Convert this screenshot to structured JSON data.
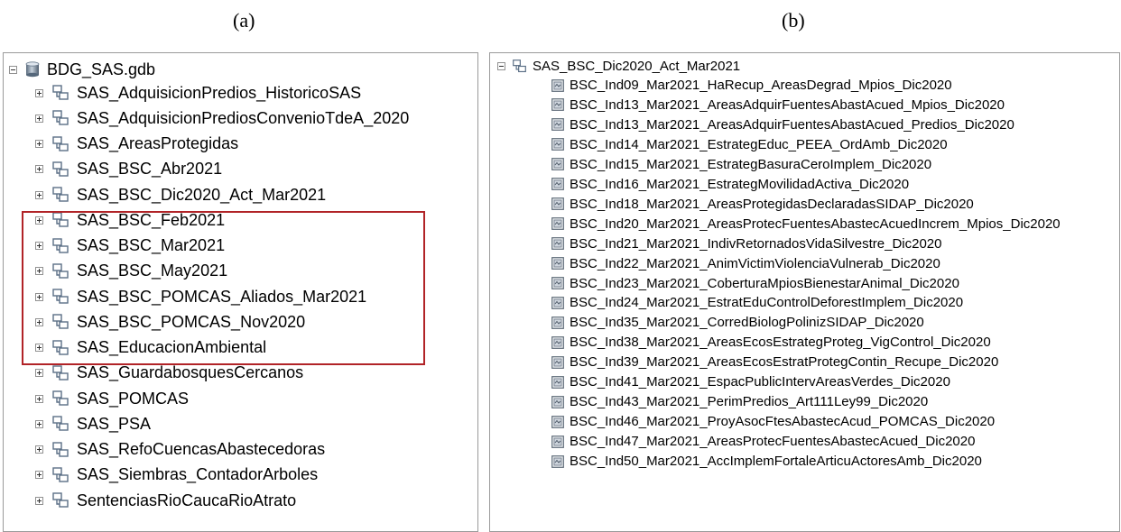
{
  "captions": {
    "left": "(a)",
    "right": "(b)"
  },
  "colors": {
    "highlight": "#b12327"
  },
  "catalog": {
    "root_label": "BDG_SAS.gdb",
    "datasets": [
      "SAS_AdquisicionPredios_HistoricoSAS",
      "SAS_AdquisicionPrediosConvenioTdeA_2020",
      "SAS_AreasProtegidas",
      "SAS_BSC_Abr2021",
      "SAS_BSC_Dic2020_Act_Mar2021",
      "SAS_BSC_Feb2021",
      "SAS_BSC_Mar2021",
      "SAS_BSC_May2021",
      "SAS_BSC_POMCAS_Aliados_Mar2021",
      "SAS_BSC_POMCAS_Nov2020",
      "SAS_EducacionAmbiental",
      "SAS_GuardabosquesCercanos",
      "SAS_POMCAS",
      "SAS_PSA",
      "SAS_RefoCuencasAbastecedoras",
      "SAS_Siembras_ContadorArboles",
      "SentenciasRioCaucaRioAtrato"
    ]
  },
  "dataset_detail": {
    "name": "SAS_BSC_Dic2020_Act_Mar2021",
    "feature_classes": [
      "BSC_Ind09_Mar2021_HaRecup_AreasDegrad_Mpios_Dic2020",
      "BSC_Ind13_Mar2021_AreasAdquirFuentesAbastAcued_Mpios_Dic2020",
      "BSC_Ind13_Mar2021_AreasAdquirFuentesAbastAcued_Predios_Dic2020",
      "BSC_Ind14_Mar2021_EstrategEduc_PEEA_OrdAmb_Dic2020",
      "BSC_Ind15_Mar2021_EstrategBasuraCeroImplem_Dic2020",
      "BSC_Ind16_Mar2021_EstrategMovilidadActiva_Dic2020",
      "BSC_Ind18_Mar2021_AreasProtegidasDeclaradasSIDAP_Dic2020",
      "BSC_Ind20_Mar2021_AreasProtecFuentesAbastecAcuedIncrem_Mpios_Dic2020",
      "BSC_Ind21_Mar2021_IndivRetornadosVidaSilvestre_Dic2020",
      "BSC_Ind22_Mar2021_AnimVictimViolenciaVulnerab_Dic2020",
      "BSC_Ind23_Mar2021_CoberturaMpiosBienestarAnimal_Dic2020",
      "BSC_Ind24_Mar2021_EstratEduControlDeforestImplem_Dic2020",
      "BSC_Ind35_Mar2021_CorredBiologPolinizSIDAP_Dic2020",
      "BSC_Ind38_Mar2021_AreasEcosEstrategProteg_VigControl_Dic2020",
      "BSC_Ind39_Mar2021_AreasEcosEstratProtegContin_Recupe_Dic2020",
      "BSC_Ind41_Mar2021_EspacPublicIntervAreasVerdes_Dic2020",
      "BSC_Ind43_Mar2021_PerimPredios_Art111Ley99_Dic2020",
      "BSC_Ind46_Mar2021_ProyAsocFtesAbastecAcud_POMCAS_Dic2020",
      "BSC_Ind47_Mar2021_AreasProtecFuentesAbastecAcued_Dic2020",
      "BSC_Ind50_Mar2021_AccImplemFortaleArticuActoresAmb_Dic2020"
    ]
  }
}
